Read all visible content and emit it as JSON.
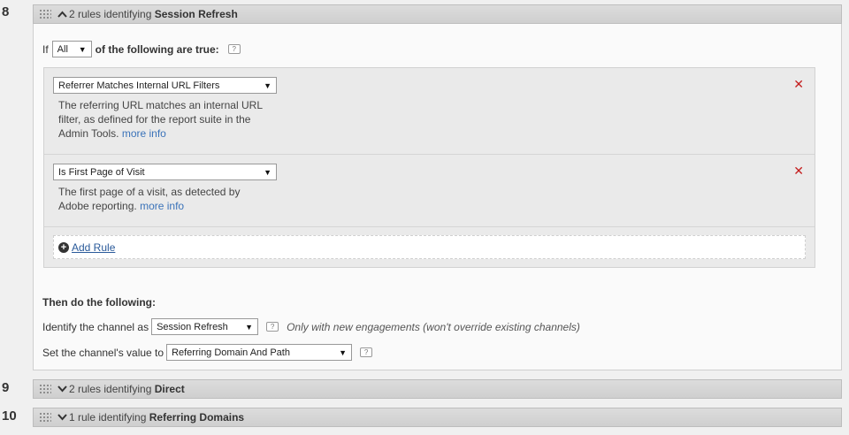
{
  "panels": [
    {
      "num": "8",
      "summary_prefix": "2 rules identifying",
      "summary_name": "Session Refresh",
      "expanded": true
    },
    {
      "num": "9",
      "summary_prefix": "2 rules identifying",
      "summary_name": "Direct",
      "expanded": false
    },
    {
      "num": "10",
      "summary_prefix": "1 rule identifying",
      "summary_name": "Referring Domains",
      "expanded": false
    }
  ],
  "condition": {
    "if_label": "If",
    "match_value": "All",
    "suffix": "of the following are true:",
    "help_icon": "help-icon"
  },
  "rules": [
    {
      "select_value": "Referrer Matches Internal URL Filters",
      "description": "The referring URL matches an internal URL filter, as defined for the report suite in the Admin Tools.",
      "more_info": "more info"
    },
    {
      "select_value": "Is First Page of Visit",
      "description": "The first page of a visit, as detected by Adobe reporting.",
      "more_info": "more info"
    }
  ],
  "add_rule_label": "Add Rule",
  "then": {
    "heading": "Then do the following:",
    "identify_label": "Identify the channel as",
    "identify_value": "Session Refresh",
    "identify_note": "Only with new engagements (won't override existing channels)",
    "value_label": "Set the channel's value to",
    "value_value": "Referring Domain And Path"
  },
  "colors": {
    "remove": "#c41e1e",
    "link": "#3b73b9"
  }
}
